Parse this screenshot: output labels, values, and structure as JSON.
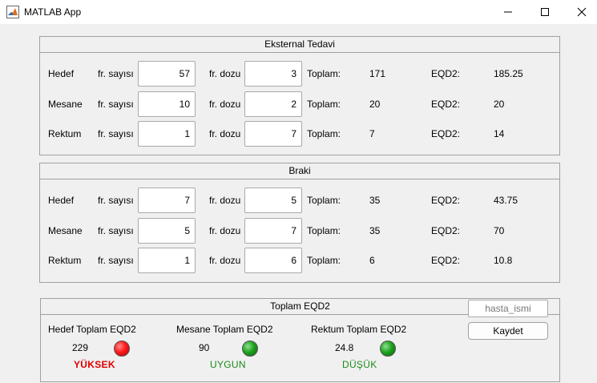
{
  "window": {
    "title": "MATLAB App"
  },
  "labels": {
    "fr_sayisi": "fr. sayısı",
    "fr_dozu": "fr. dozu",
    "toplam": "Toplam:",
    "eqd2": "EQD2:"
  },
  "eksternal": {
    "title": "Eksternal Tedavi",
    "rows": [
      {
        "name": "Hedef",
        "fr_sayisi": "57",
        "fr_dozu": "3",
        "toplam": "171",
        "eqd2": "185.25"
      },
      {
        "name": "Mesane",
        "fr_sayisi": "10",
        "fr_dozu": "2",
        "toplam": "20",
        "eqd2": "20"
      },
      {
        "name": "Rektum",
        "fr_sayisi": "1",
        "fr_dozu": "7",
        "toplam": "7",
        "eqd2": "14"
      }
    ]
  },
  "braki": {
    "title": "Braki",
    "rows": [
      {
        "name": "Hedef",
        "fr_sayisi": "7",
        "fr_dozu": "5",
        "toplam": "35",
        "eqd2": "43.75"
      },
      {
        "name": "Mesane",
        "fr_sayisi": "5",
        "fr_dozu": "7",
        "toplam": "35",
        "eqd2": "70"
      },
      {
        "name": "Rektum",
        "fr_sayisi": "1",
        "fr_dozu": "6",
        "toplam": "6",
        "eqd2": "10.8"
      }
    ]
  },
  "toplam": {
    "title": "Toplam EQD2",
    "items": [
      {
        "label": "Hedef Toplam EQD2",
        "value": "229",
        "status": "YÜKSEK",
        "status_color": "#e00000",
        "lamp_color": "red"
      },
      {
        "label": "Mesane Toplam EQD2",
        "value": "90",
        "status": "UYGUN",
        "status_color": "#1a8a1a",
        "lamp_color": "green"
      },
      {
        "label": "Rektum Toplam EQD2",
        "value": "24.8",
        "status": "DÜŞÜK",
        "status_color": "#1a8a1a",
        "lamp_color": "green"
      }
    ]
  },
  "patient": {
    "placeholder": "hasta_ismi",
    "value": ""
  },
  "save_label": "Kaydet",
  "icons": {
    "app": "matlab-icon",
    "minimize": "minimize-icon",
    "maximize": "maximize-icon",
    "close": "close-icon"
  }
}
